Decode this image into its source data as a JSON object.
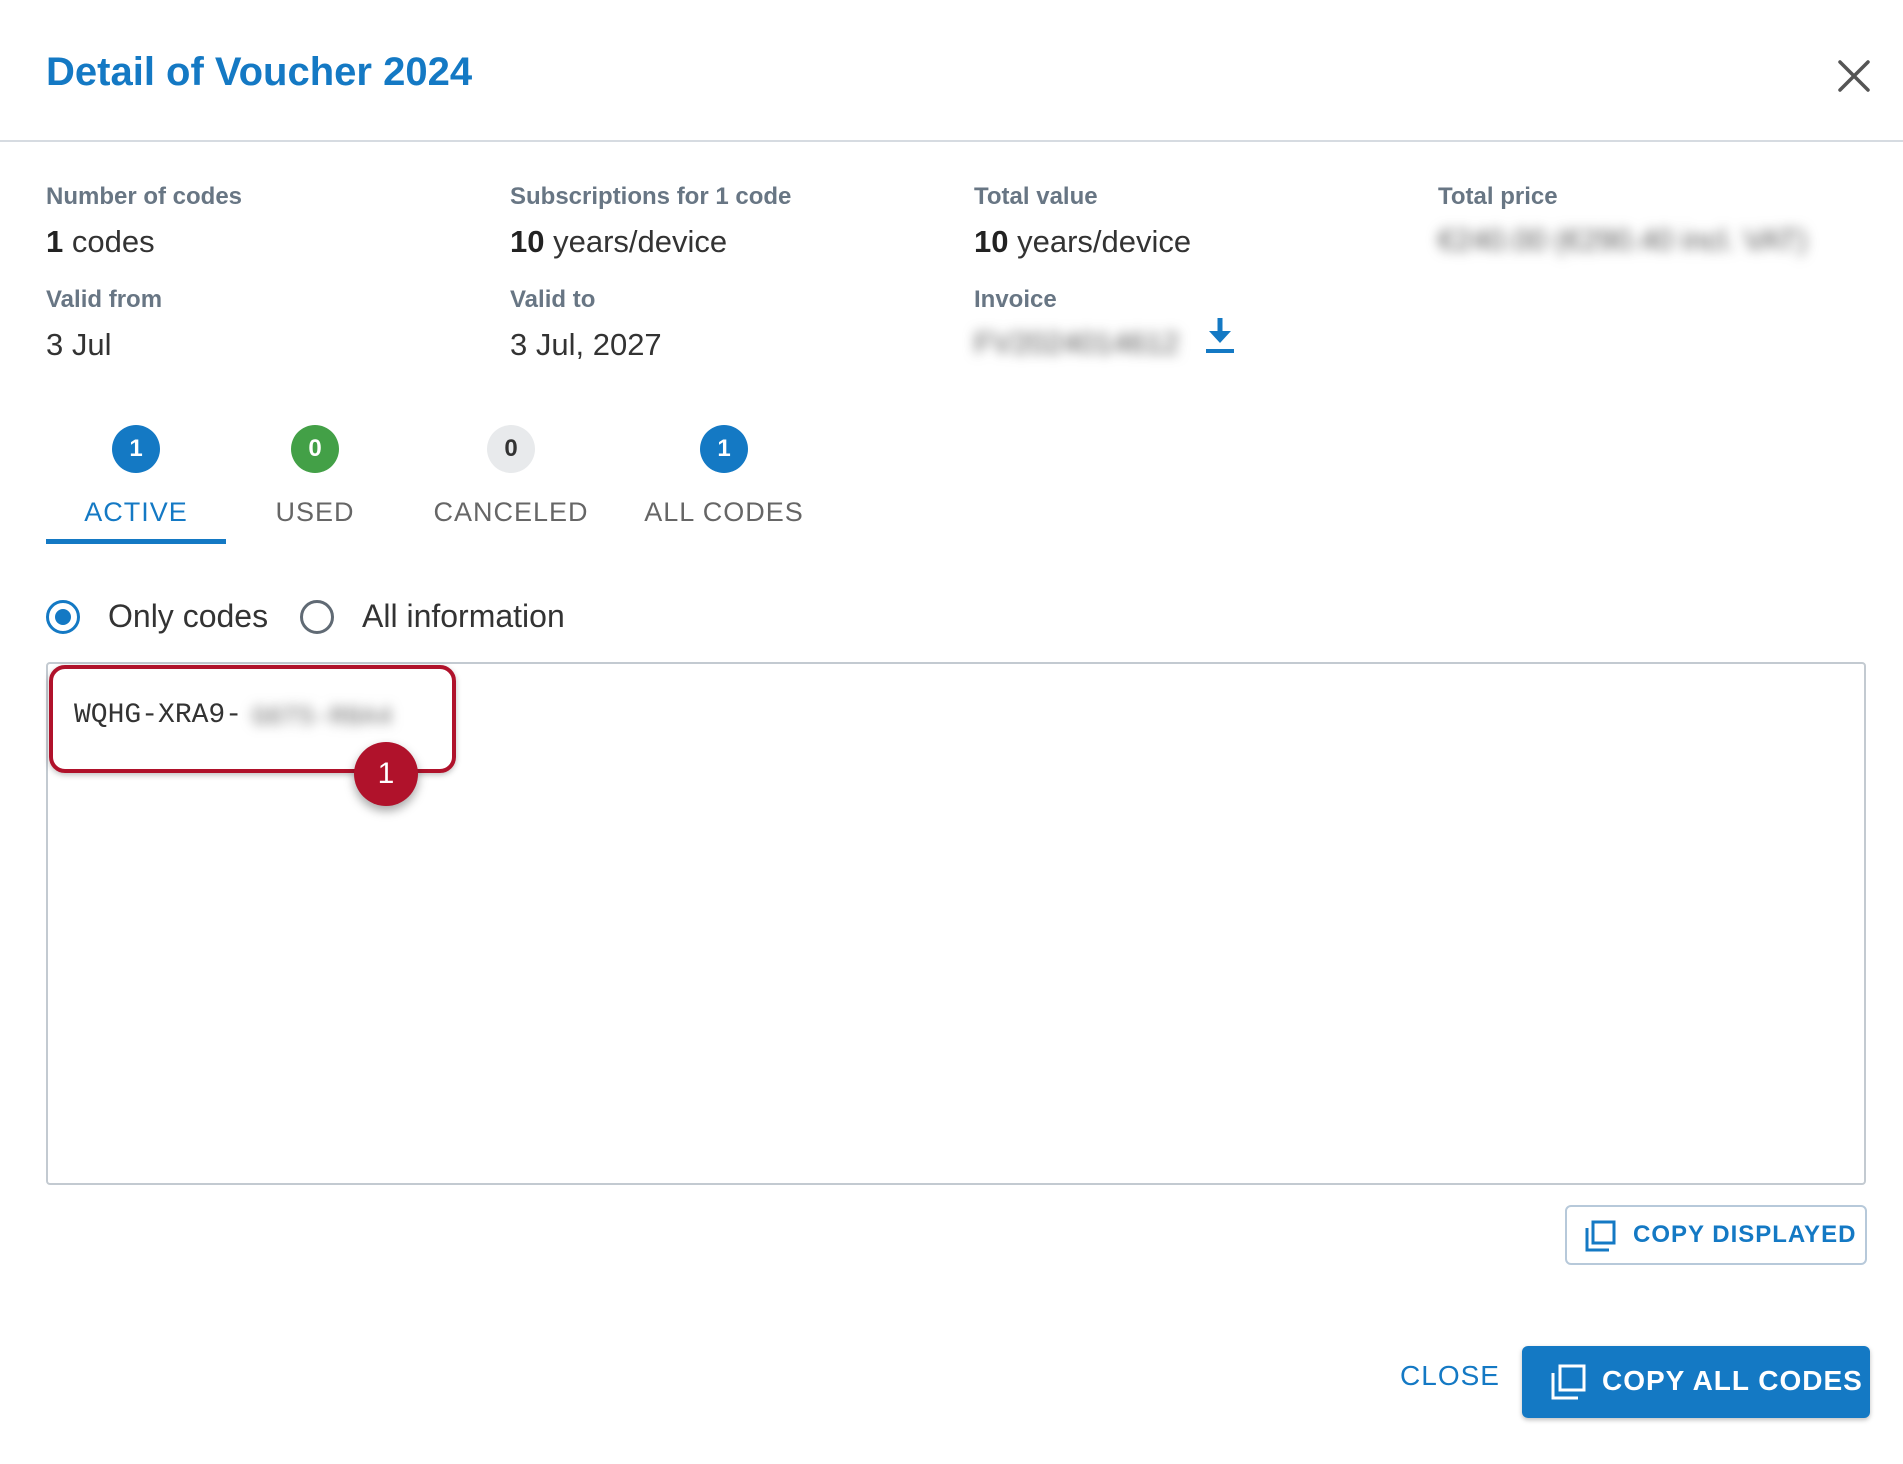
{
  "dialog": {
    "title": "Detail of Voucher 2024",
    "close_icon": "close-icon"
  },
  "info": {
    "number_of_codes": {
      "label": "Number of codes",
      "value_bold": "1",
      "value_rest": " codes"
    },
    "subscriptions": {
      "label": "Subscriptions for 1 code",
      "value_bold": "10",
      "value_rest": " years/device"
    },
    "total_value": {
      "label": "Total value",
      "value_bold": "10",
      "value_rest": " years/device"
    },
    "total_price": {
      "label": "Total price",
      "value": "€240.00 (€290.40 incl. VAT)"
    },
    "valid_from": {
      "label": "Valid from",
      "value": "3 Jul"
    },
    "valid_to": {
      "label": "Valid to",
      "value": "3 Jul, 2027"
    },
    "invoice": {
      "label": "Invoice",
      "value": "FV2024014612",
      "icon": "download-icon"
    }
  },
  "tabs": [
    {
      "label": "ACTIVE",
      "count": "1",
      "badge_color": "#1479c4",
      "badge_text_color": "#ffffff",
      "active": true
    },
    {
      "label": "USED",
      "count": "0",
      "badge_color": "#43a047",
      "badge_text_color": "#ffffff",
      "active": false
    },
    {
      "label": "CANCELED",
      "count": "0",
      "badge_color": "#e8eaec",
      "badge_text_color": "#333333",
      "active": false
    },
    {
      "label": "ALL CODES",
      "count": "1",
      "badge_color": "#1479c4",
      "badge_text_color": "#ffffff",
      "active": false
    }
  ],
  "display_mode": {
    "options": [
      {
        "label": "Only codes",
        "checked": true
      },
      {
        "label": "All information",
        "checked": false
      }
    ]
  },
  "codes": {
    "visible_prefix": "WQHG-XRA9-",
    "hidden_suffix": "G6T5-R8A4"
  },
  "callout": {
    "number": "1",
    "color": "#b0122b"
  },
  "buttons": {
    "copy_displayed": "COPY DISPLAYED",
    "close": "CLOSE",
    "copy_all": "COPY ALL CODES"
  },
  "colors": {
    "accent": "#1479c4",
    "label_gray": "#687684",
    "highlight": "#b0122b"
  }
}
